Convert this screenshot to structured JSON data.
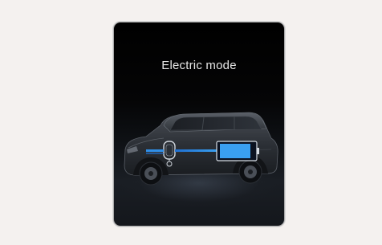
{
  "screen": {
    "title": "Electric mode",
    "mode": "electric",
    "battery_charge_level": 0.9
  },
  "colors": {
    "background": "#f4f1ef",
    "panel_bg": "#000000",
    "title_text": "#e6e6e6",
    "energy_flow": "#2f8fe8",
    "battery_fill": "#3aa0f0"
  },
  "icons": {
    "car": "suv-side-view-icon",
    "motor": "electric-motor-icon",
    "battery": "battery-icon",
    "energy_flow": "energy-flow-arrow-icon"
  }
}
